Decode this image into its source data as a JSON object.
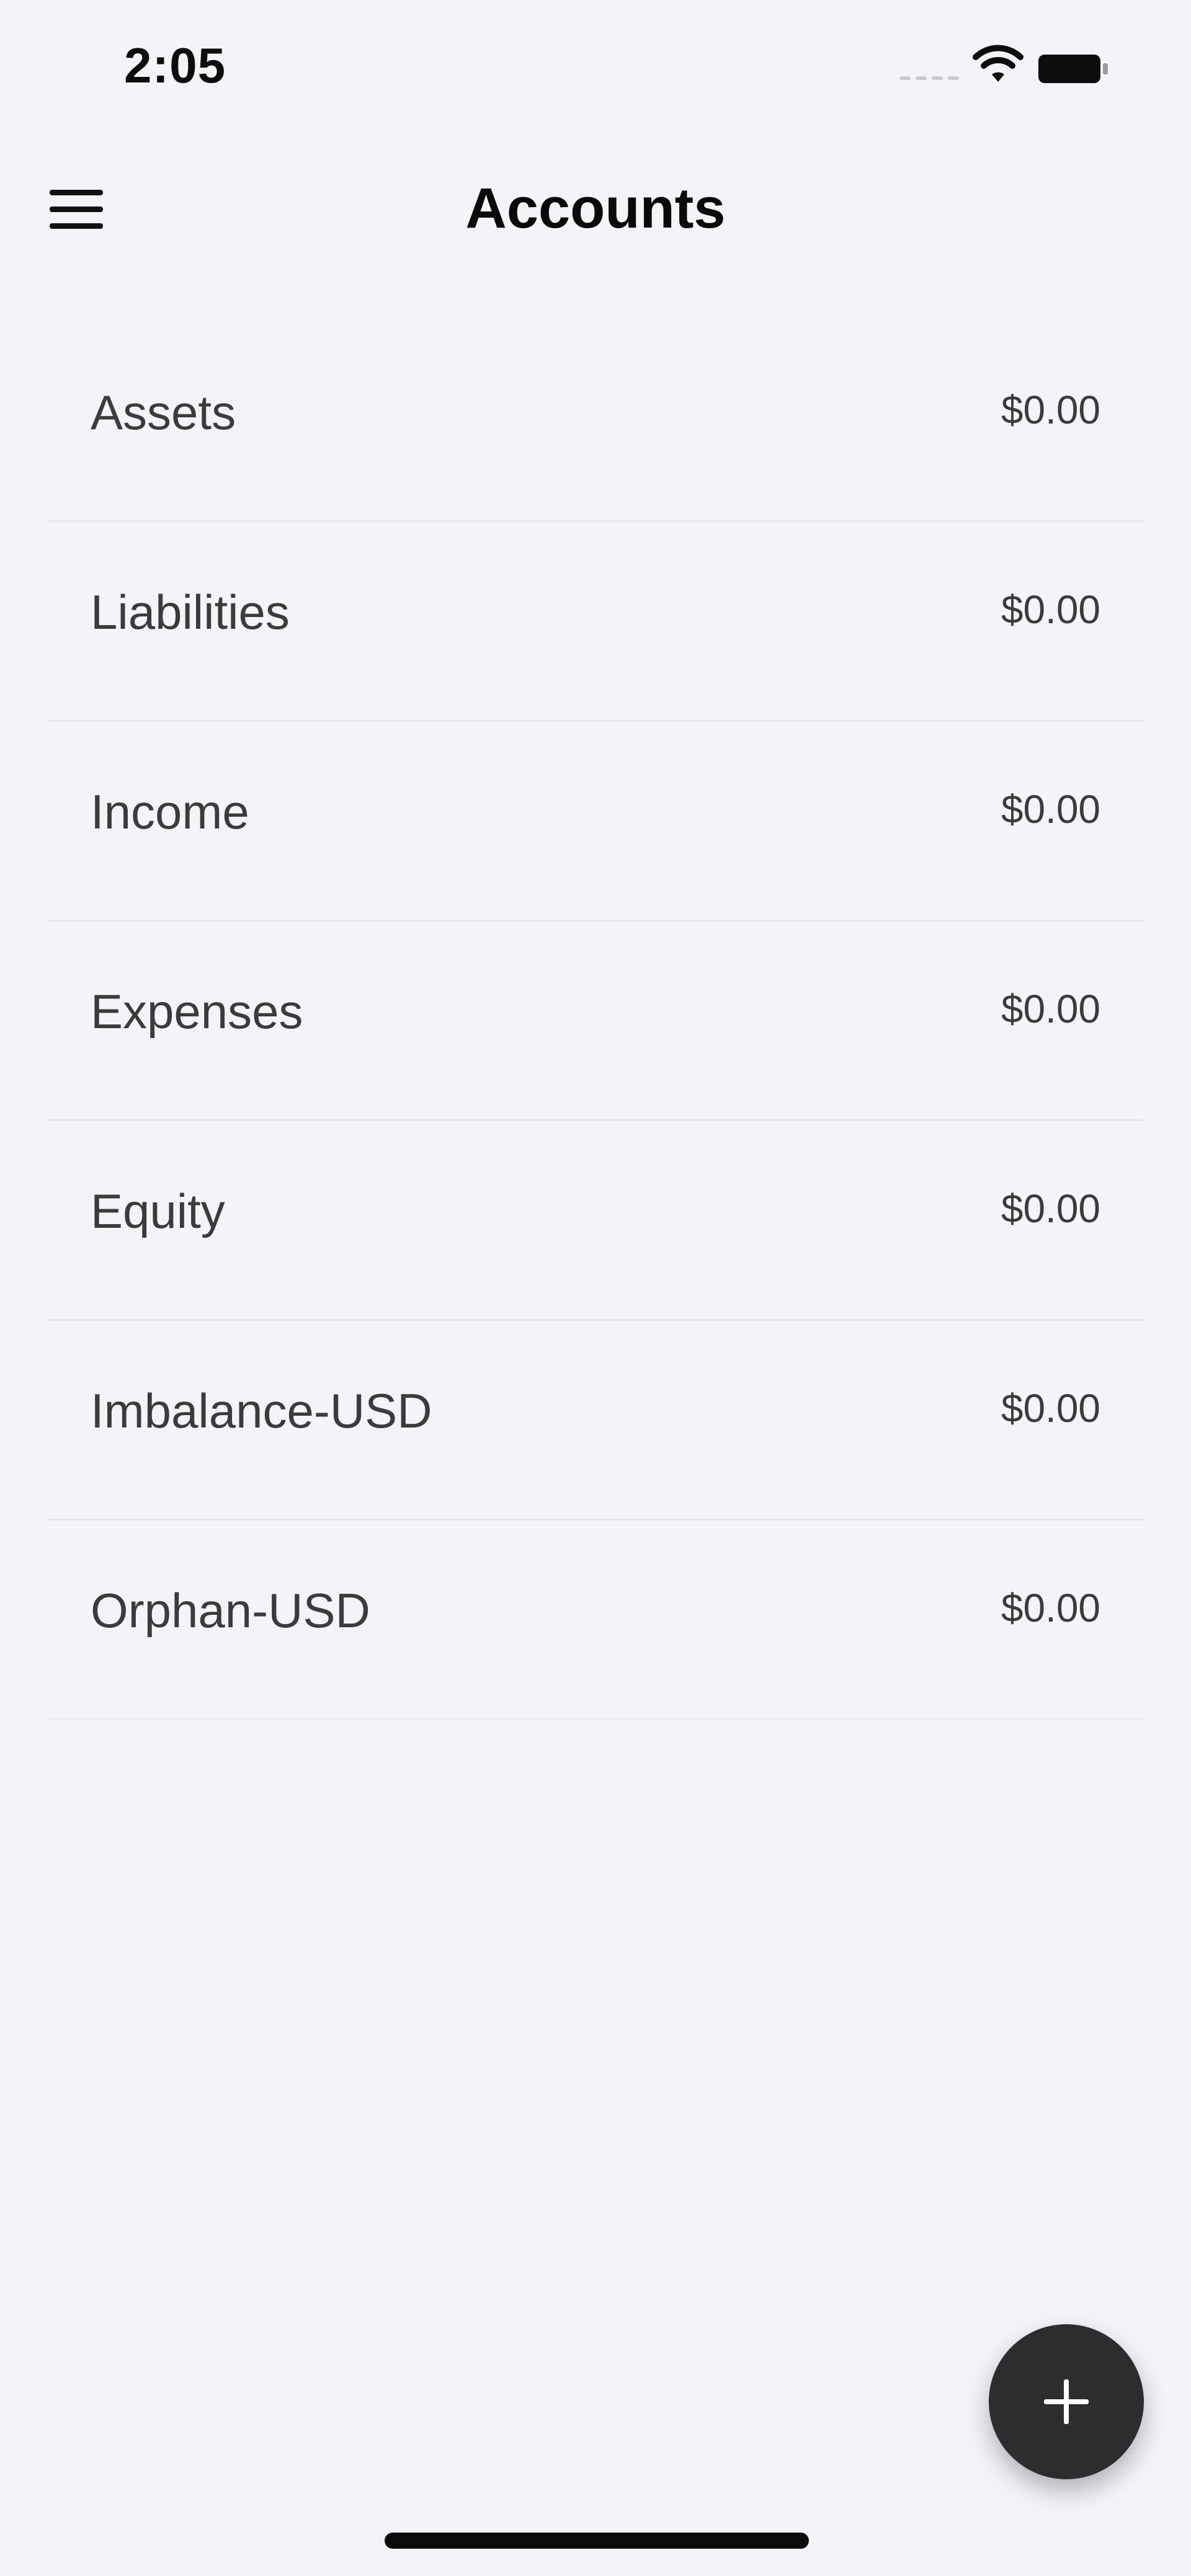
{
  "status_bar": {
    "time": "2:05",
    "icons": [
      "cellular-signal-icon",
      "wifi-icon",
      "battery-icon"
    ]
  },
  "header": {
    "title": "Accounts",
    "menu_icon": "hamburger-menu-icon"
  },
  "accounts": [
    {
      "name": "Assets",
      "balance": "$0.00"
    },
    {
      "name": "Liabilities",
      "balance": "$0.00"
    },
    {
      "name": "Income",
      "balance": "$0.00"
    },
    {
      "name": "Expenses",
      "balance": "$0.00"
    },
    {
      "name": "Equity",
      "balance": "$0.00"
    },
    {
      "name": "Imbalance-USD",
      "balance": "$0.00"
    },
    {
      "name": "Orphan-USD",
      "balance": "$0.00"
    }
  ],
  "fab": {
    "icon": "plus-icon"
  },
  "colors": {
    "background": "#f3f4f8",
    "fab": "#2c2d2f",
    "text_primary": "#0a0a0a",
    "text_secondary": "#3b3b3b",
    "divider": "#e6e7ec"
  }
}
